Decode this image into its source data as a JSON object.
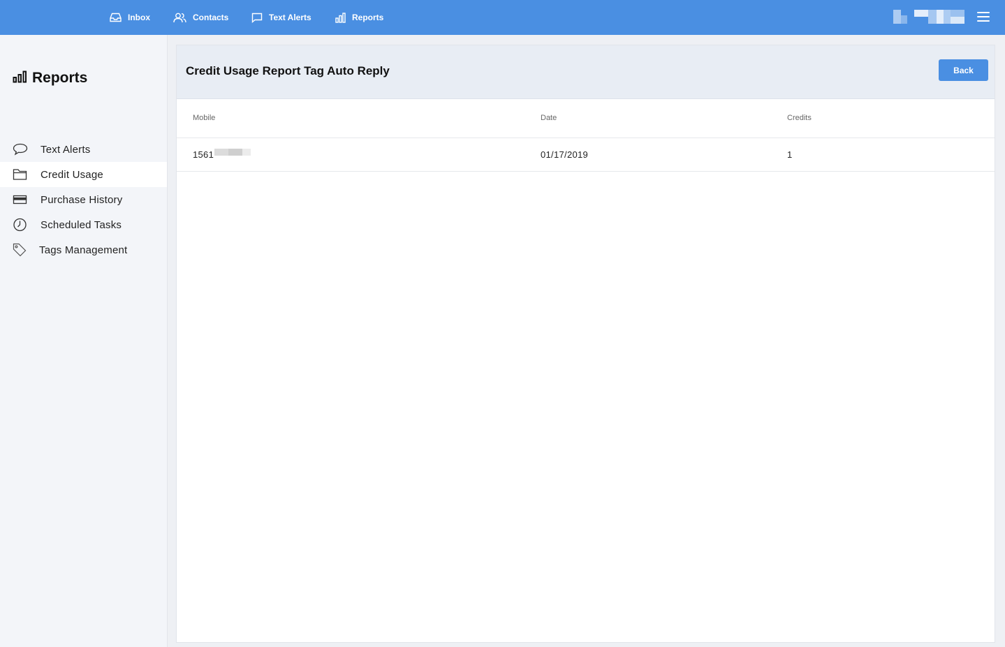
{
  "nav": {
    "items": [
      {
        "label": "Inbox",
        "icon": "inbox-icon"
      },
      {
        "label": "Contacts",
        "icon": "contacts-icon"
      },
      {
        "label": "Text Alerts",
        "icon": "chat-bubble-icon"
      },
      {
        "label": "Reports",
        "icon": "bar-chart-icon"
      }
    ]
  },
  "sidebar": {
    "title": "Reports",
    "items": [
      {
        "label": "Text Alerts",
        "icon": "chat-bubble-icon",
        "active": false
      },
      {
        "label": "Credit Usage",
        "icon": "folder-icon",
        "active": true
      },
      {
        "label": "Purchase History",
        "icon": "credit-card-icon",
        "active": false
      },
      {
        "label": "Scheduled Tasks",
        "icon": "clock-icon",
        "active": false
      },
      {
        "label": "Tags Management",
        "icon": "tag-icon",
        "active": false
      }
    ]
  },
  "main": {
    "title": "Credit Usage Report Tag Auto Reply",
    "back_label": "Back",
    "table": {
      "columns": [
        "Mobile",
        "Date",
        "Credits"
      ],
      "rows": [
        {
          "mobile": "1561",
          "date": "01/17/2019",
          "credits": "1"
        }
      ]
    }
  },
  "colors": {
    "accent": "#4a8fe2",
    "header_bg": "#e8edf4",
    "sidebar_bg": "#f3f5f9"
  }
}
